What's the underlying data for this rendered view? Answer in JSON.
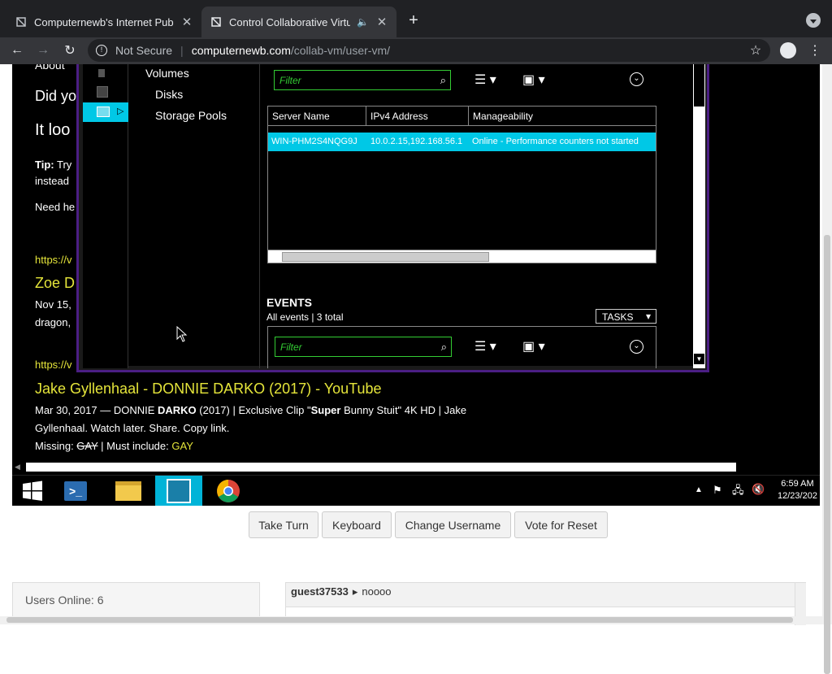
{
  "tabs": [
    {
      "title": "Computernewb's Internet Pub",
      "active": false
    },
    {
      "title": "Control Collaborative Virtu",
      "active": true
    }
  ],
  "address": {
    "security": "Not Secure",
    "host": "computernewb.com",
    "path": "/collab-vm/user-vm/"
  },
  "vm": {
    "page": {
      "about": "About",
      "did_you": "Did yo",
      "it_looks": "It loo",
      "tip_label": "Tip:",
      "tip_text": "Try",
      "instead": "instead",
      "need_help": "Need he",
      "link1": "https://v",
      "result1_title": "Zoe D",
      "result1_date": "Nov 15,",
      "result1_text": "dragon,",
      "link2": "https://v",
      "result2_title": "Jake Gyllenhaal - DONNIE DARKO (2017) - YouTube",
      "result2_date_prefix": "Mar 30, 2017 — DONNIE ",
      "result2_bold1": "DARKO",
      "result2_mid": " (2017) | Exclusive Clip \"",
      "result2_bold2": "Super",
      "result2_rest": " Bunny Stuit\" 4K HD | Jake",
      "result2_line2": "Gyllenhaal. Watch later. Share. Copy link.",
      "missing_label": "Missing: ",
      "missing_word": "GAY",
      "must_include_label": " | Must include: ",
      "must_include_word": "GAY"
    },
    "server_manager": {
      "nav": {
        "volumes": "Volumes",
        "disks": "Disks",
        "storage_pools": "Storage Pools"
      },
      "filter_placeholder": "Filter",
      "columns": [
        "Server Name",
        "IPv4 Address",
        "Manageability"
      ],
      "row": {
        "server": "WIN-PHM2S4NQG9J",
        "ip": "10.0.2.15,192.168.56.1",
        "manageability": "Online - Performance counters not started"
      },
      "events_title": "EVENTS",
      "events_summary": "All events | 3 total",
      "tasks_label": "TASKS",
      "events_filter": "Filter"
    },
    "taskbar": {
      "time": "6:59 AM",
      "date": "12/23/202"
    }
  },
  "controls": {
    "take_turn": "Take Turn",
    "keyboard": "Keyboard",
    "change_username": "Change Username",
    "vote_reset": "Vote for Reset"
  },
  "users_online": "Users Online: 6",
  "chat": {
    "user": "guest37533",
    "message": "noooo"
  },
  "colors": {
    "accent_yellow": "#e5e53a",
    "selected_row": "#00c8e6",
    "window_border": "#4b1e84",
    "filter_green": "#33cc33"
  }
}
